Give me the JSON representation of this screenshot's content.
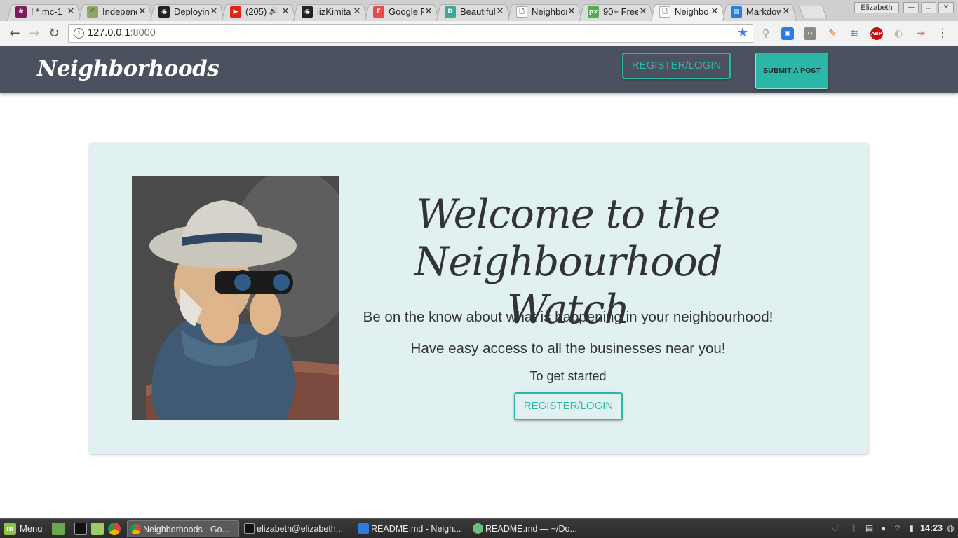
{
  "browser": {
    "tabs": [
      {
        "title": "! * mc-1",
        "favicon_color": "#7b1e5a",
        "favicon_glyph": "#"
      },
      {
        "title": "Independ",
        "favicon_color": "#8ca66a",
        "favicon_glyph": "🌴"
      },
      {
        "title": "Deploying",
        "favicon_color": "#222222",
        "favicon_glyph": "◉"
      },
      {
        "title": "(205)",
        "favicon_color": "#e62117",
        "favicon_glyph": "▶",
        "audio": "🔊"
      },
      {
        "title": "lizKimita",
        "favicon_color": "#222222",
        "favicon_glyph": "◉"
      },
      {
        "title": "Google Fo",
        "favicon_color": "#e94b4b",
        "favicon_glyph": "F"
      },
      {
        "title": "Beautiful",
        "favicon_color": "#3aa89b",
        "favicon_glyph": "D"
      },
      {
        "title": "Neighbor",
        "favicon_color": "#ffffff",
        "favicon_glyph": "🗋"
      },
      {
        "title": "90+ Free",
        "favicon_color": "#4caf50",
        "favicon_glyph": "px"
      },
      {
        "title": "Neighbo",
        "favicon_color": "#ffffff",
        "favicon_glyph": "🗋",
        "active": true
      },
      {
        "title": "Markdow",
        "favicon_color": "#2a7de1",
        "favicon_glyph": "▤"
      }
    ],
    "profile_name": "Elizabeth",
    "address": {
      "host": "127.0.0.1",
      "port": ":8000"
    }
  },
  "site": {
    "brand": "Neighborhoods",
    "nav_login_label": "REGISTER/LOGIN",
    "nav_submit_label": "SUBMIT A POST"
  },
  "hero": {
    "title_line1": "Welcome to the",
    "title_line2": "Neighbourhood Watch",
    "line1": "Be on the know about what is happening in your neighbourhood!",
    "line2": "Have easy access to all the businesses near you!",
    "line3": "To get started",
    "login_label": "REGISTER/LOGIN"
  },
  "taskbar": {
    "menu_label": "Menu",
    "tasks": [
      "Neighborhoods - Go...",
      "elizabeth@elizabeth...",
      "README.md - Neigh...",
      "README.md — ~/Do..."
    ],
    "clock": "14:23"
  },
  "colors": {
    "accent": "#2bb7a8",
    "navbar": "#4a525f",
    "card": "#e1f0f0"
  }
}
